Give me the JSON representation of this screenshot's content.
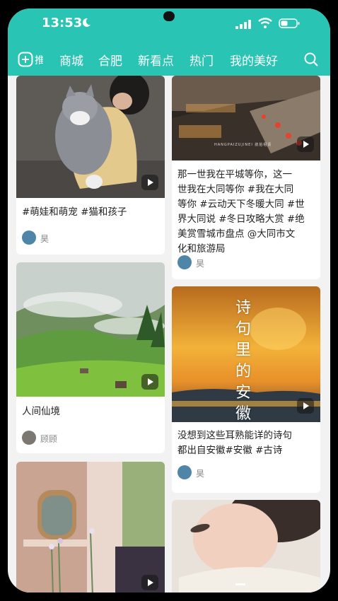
{
  "status": {
    "time": "13:53"
  },
  "nav": {
    "cut_tab": "推荐",
    "tabs": [
      "商城",
      "合肥",
      "新看点",
      "热门",
      "我的美好"
    ]
  },
  "cards": [
    {
      "caption": "#萌娃和萌宠  #猫和孩子",
      "author": "昊"
    },
    {
      "caption_lines": [
        "那一世我在平城等你，这一",
        "世我在大同等你 #我在大同",
        "等你 #云动天下冬暖大同 #世",
        "界大同说 #冬日攻略大赏 #绝",
        "美赏雪城市盘点 @大同市文",
        "化和旅游局"
      ],
      "author": "昊",
      "watermark": "HANGPAIZUJINEI 航拍租赁"
    },
    {
      "caption": "人间仙境",
      "author": "顾顾"
    },
    {
      "caption_lines": [
        "没想到这些耳熟能详的诗句",
        "都出自安徽#安徽 #古诗"
      ],
      "author": "昊",
      "overlay_chars": [
        "诗",
        "句",
        "里",
        "的",
        "安",
        "徽"
      ]
    },
    {
      "caption": "",
      "author": ""
    },
    {
      "caption": "",
      "author": ""
    }
  ]
}
